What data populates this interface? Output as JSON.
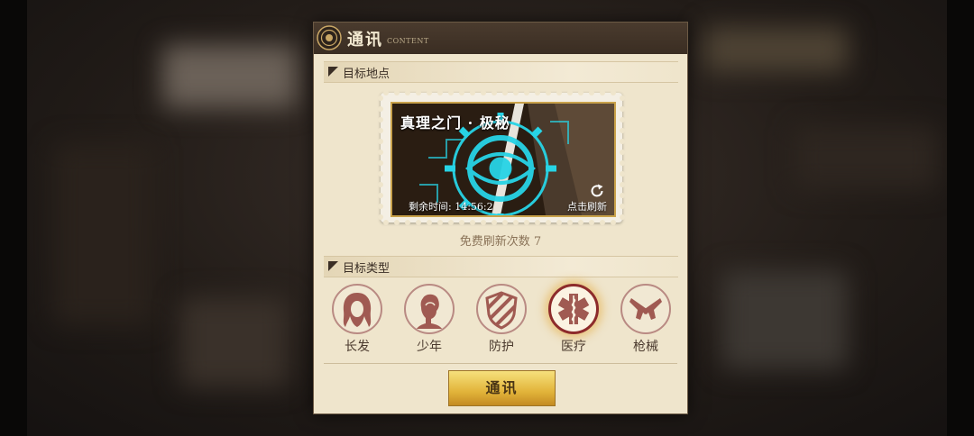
{
  "dialog": {
    "title": "通讯",
    "title_sub": "CONTENT",
    "close_icon": "close-icon"
  },
  "target_location": {
    "header": "目标地点",
    "card": {
      "title": "真理之门 · 极秘",
      "remaining_time": "剩余时间: 14:56:2",
      "refresh_label": "点击刷新",
      "refresh_icon": "refresh-icon"
    },
    "free_refresh": "免费刷新次数 7"
  },
  "target_type": {
    "header": "目标类型",
    "items": [
      {
        "label": "长发",
        "icon": "long-hair-icon",
        "selected": false
      },
      {
        "label": "少年",
        "icon": "youth-icon",
        "selected": false
      },
      {
        "label": "防护",
        "icon": "shield-icon",
        "selected": false
      },
      {
        "label": "医疗",
        "icon": "medical-icon",
        "selected": true
      },
      {
        "label": "枪械",
        "icon": "guns-icon",
        "selected": false
      }
    ]
  },
  "action_button": "通讯",
  "colors": {
    "accent_gold": "#e2b43a",
    "selected_ring": "#8d2b2b",
    "icon_red": "#a05a52",
    "panel_bg": "#efe5cc"
  }
}
